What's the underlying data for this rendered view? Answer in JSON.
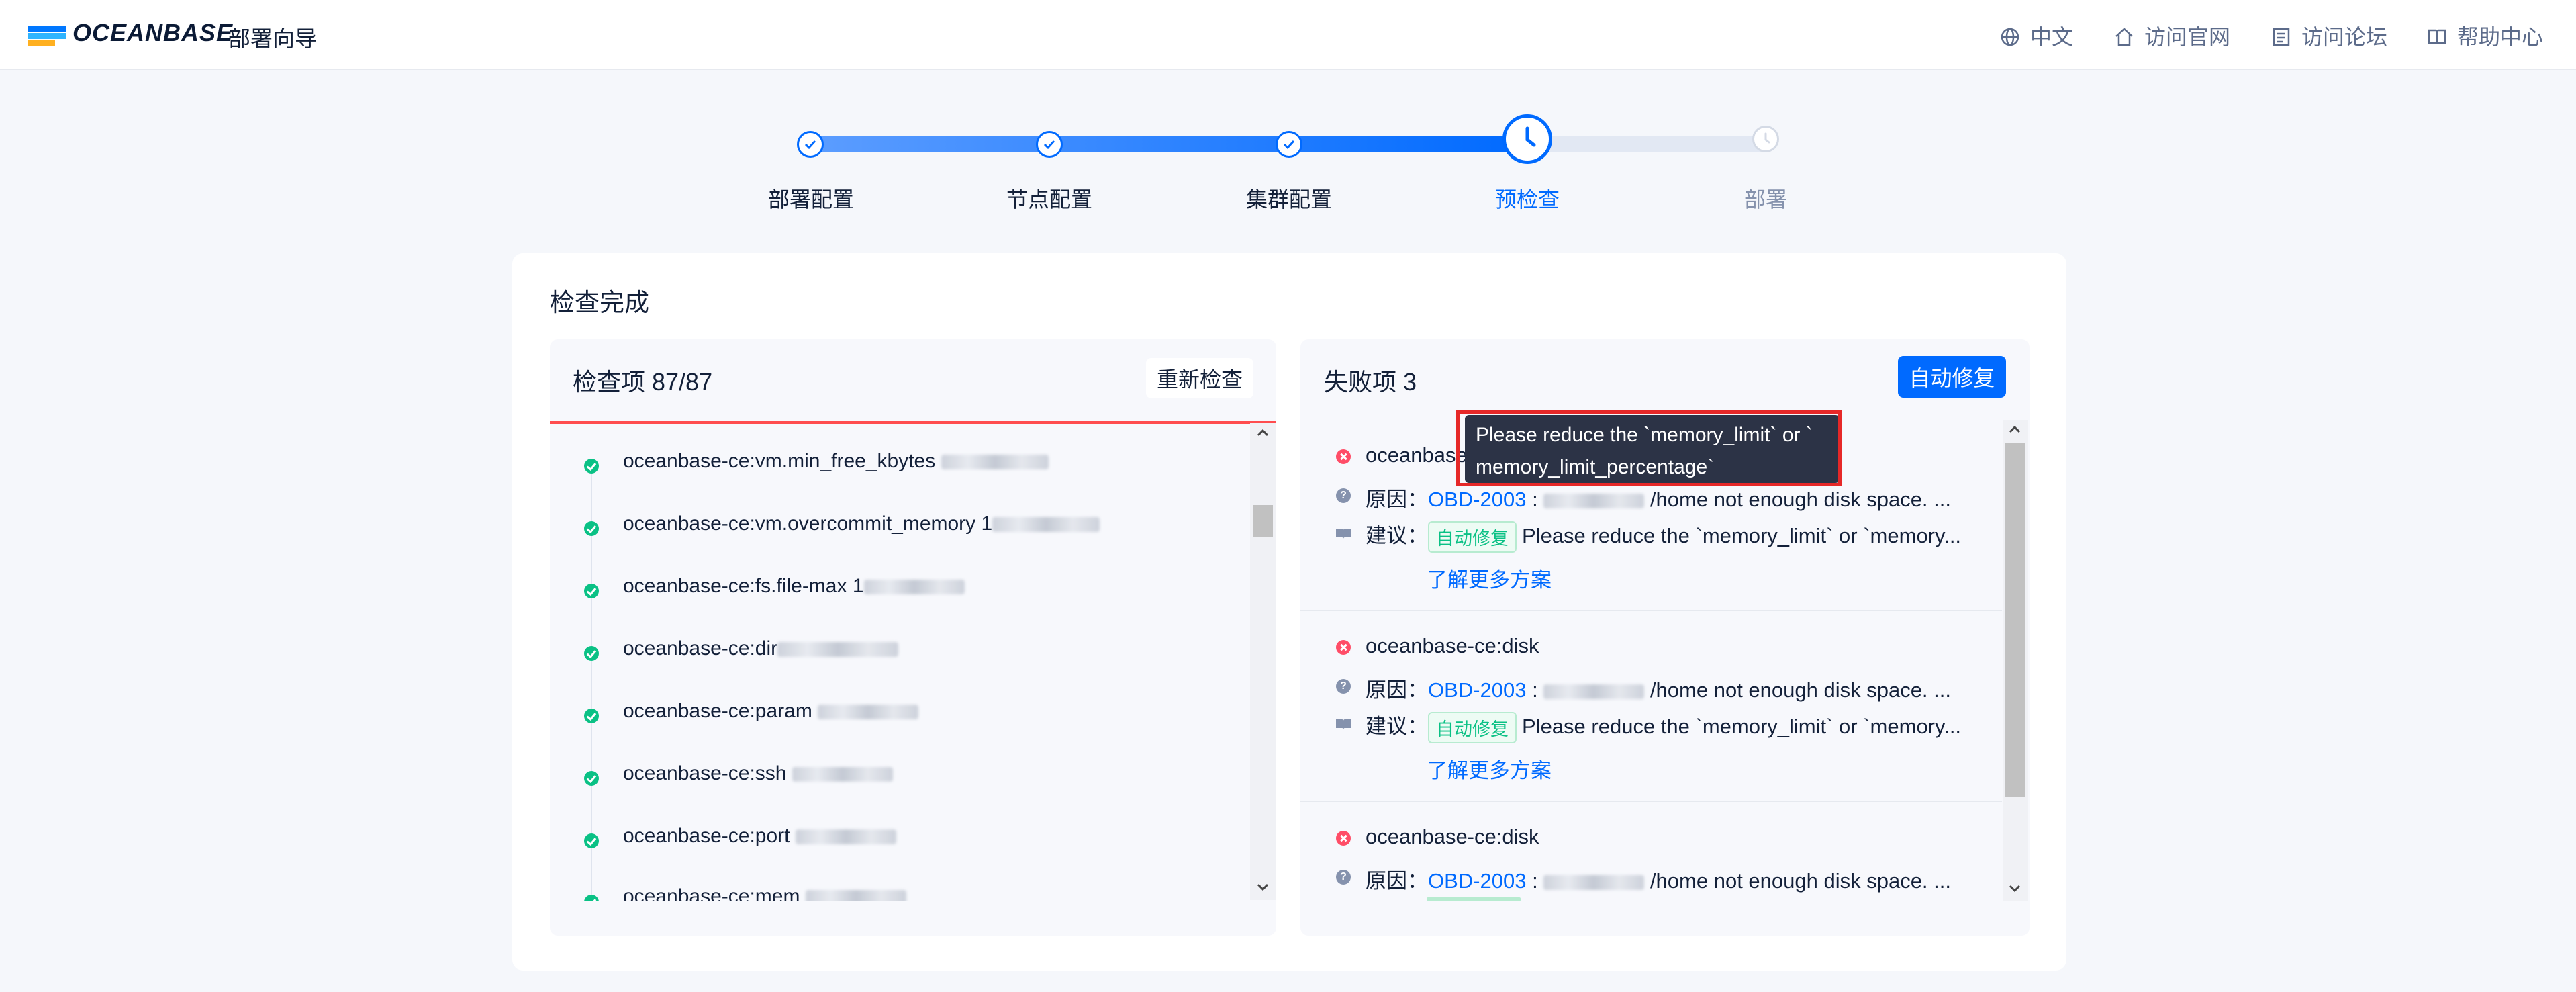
{
  "header": {
    "logo_text": "OCEANBASE",
    "subtitle": "部署向导",
    "nav": [
      {
        "label": "中文",
        "icon": "globe-icon"
      },
      {
        "label": "访问官网",
        "icon": "home-icon"
      },
      {
        "label": "访问论坛",
        "icon": "forum-icon"
      },
      {
        "label": "帮助中心",
        "icon": "book-icon"
      }
    ]
  },
  "steps": [
    {
      "label": "部署配置",
      "status": "done"
    },
    {
      "label": "节点配置",
      "status": "done"
    },
    {
      "label": "集群配置",
      "status": "done"
    },
    {
      "label": "预检查",
      "status": "current"
    },
    {
      "label": "部署",
      "status": "pending"
    }
  ],
  "card": {
    "title": "检查完成",
    "checks": {
      "title": "检查项 87/87",
      "recheck_label": "重新检查",
      "items": [
        "oceanbase-ce:vm.min_free_kbytes",
        "oceanbase-ce:vm.overcommit_memory 1",
        "oceanbase-ce:fs.file-max 1",
        "oceanbase-ce:dir",
        "oceanbase-ce:param",
        "oceanbase-ce:ssh",
        "oceanbase-ce:port",
        "oceanbase-ce:mem"
      ]
    },
    "failures": {
      "title": "失败项 3",
      "autofix_label": "自动修复",
      "reason_label": "原因：",
      "suggest_label": "建议：",
      "autofix_tag": "自动修复",
      "more_label": "了解更多方案",
      "items": [
        {
          "name": "oceanbase-ce:disk",
          "code": "OBD-2003",
          "reason": "/home not enough disk space. ...",
          "suggestion": "Please reduce the `memory_limit` or `memory..."
        },
        {
          "name": "oceanbase-ce:disk",
          "code": "OBD-2003",
          "reason": "/home not enough disk space. ...",
          "suggestion": "Please reduce the `memory_limit` or `memory..."
        },
        {
          "name": "oceanbase-ce:disk",
          "code": "OBD-2003",
          "reason": "/home not enough disk space. ..."
        }
      ]
    }
  },
  "tooltip": {
    "line1": "Please reduce the `memory_limit` or `",
    "line2": "memory_limit_percentage`"
  },
  "colors": {
    "accent": "#006aff",
    "success": "#0ac185",
    "error": "#ff4d67",
    "highlight": "#e62828"
  }
}
